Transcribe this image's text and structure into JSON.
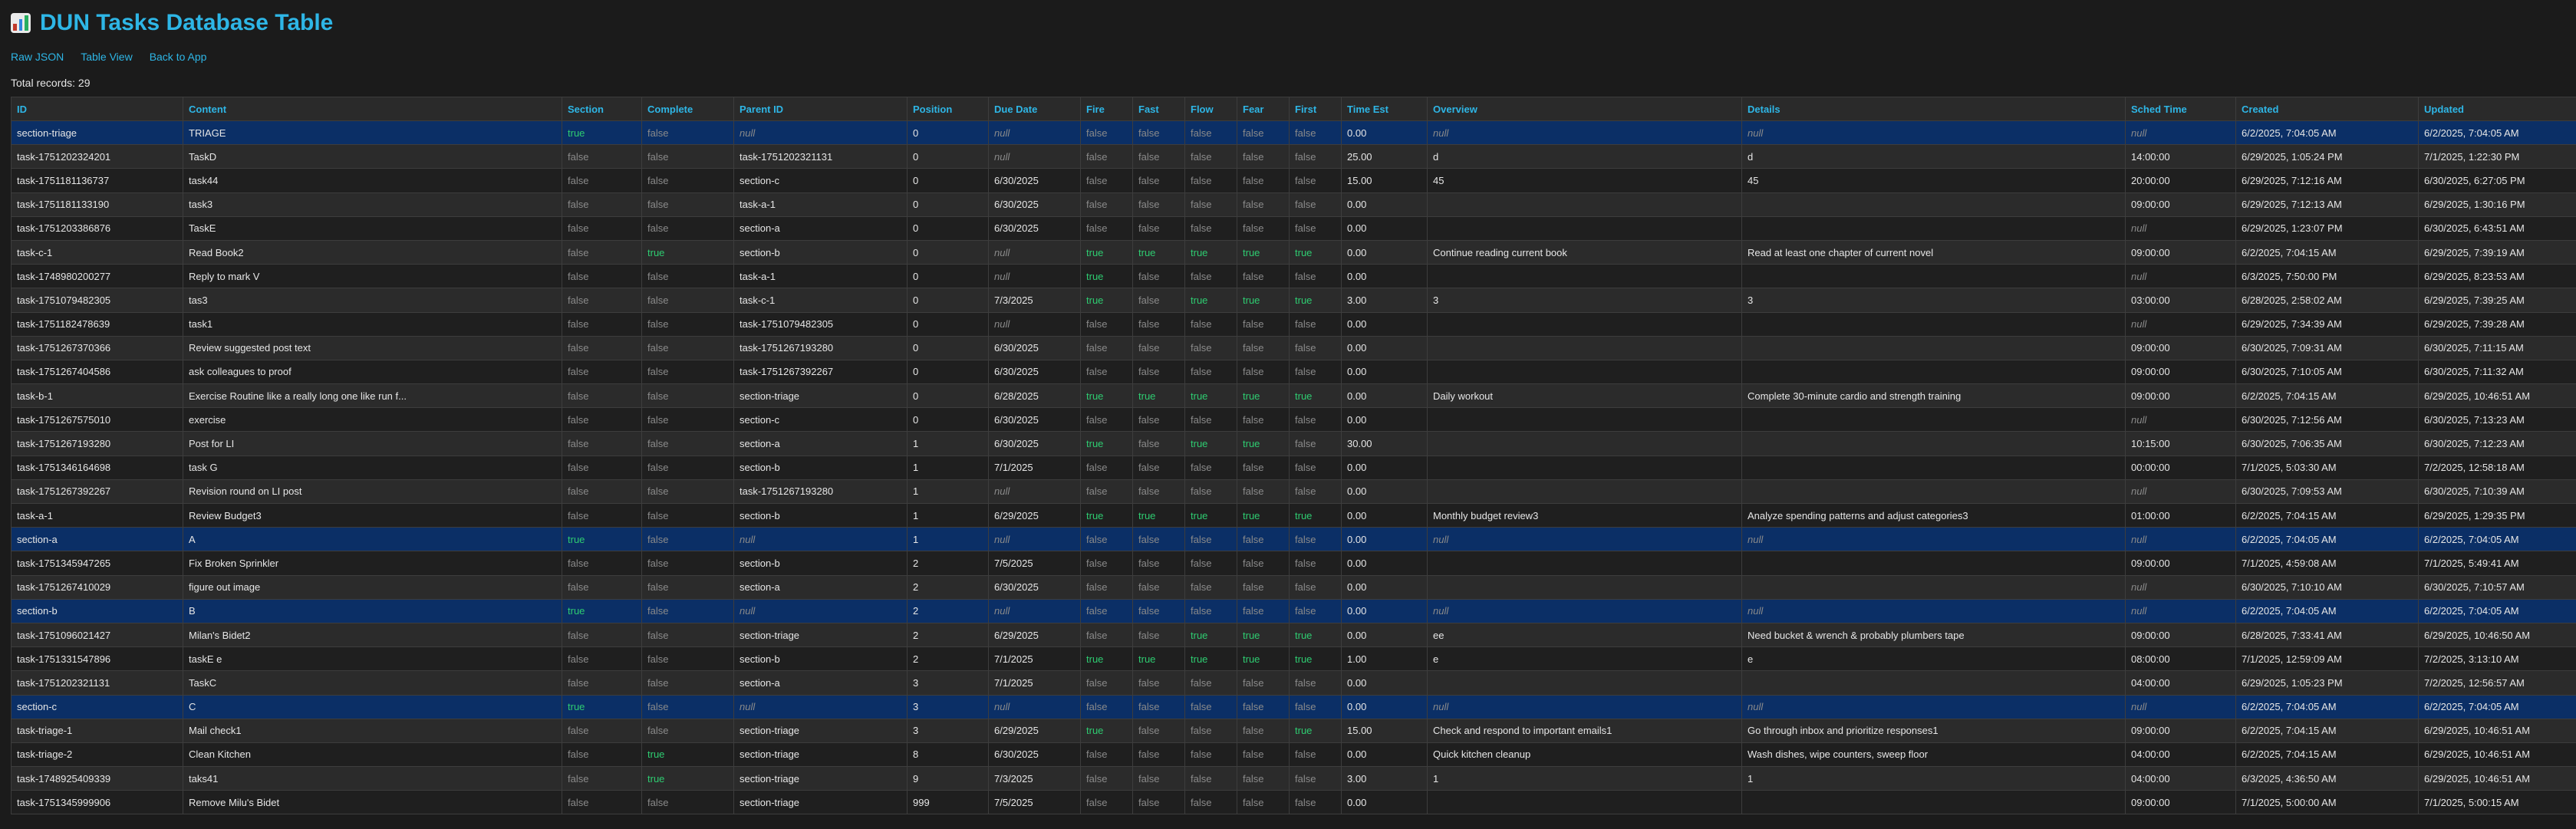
{
  "title": "DUN Tasks Database Table",
  "title_icon": "bar-chart-icon",
  "nav": [
    {
      "label": "Raw JSON"
    },
    {
      "label": "Table View"
    },
    {
      "label": "Back to App"
    }
  ],
  "total_records": "Total records: 29",
  "columns": [
    "ID",
    "Content",
    "Section",
    "Complete",
    "Parent ID",
    "Position",
    "Due Date",
    "Fire",
    "Fast",
    "Flow",
    "Fear",
    "First",
    "Time Est",
    "Overview",
    "Details",
    "Sched Time",
    "Created",
    "Updated"
  ],
  "rows": [
    [
      "section-triage",
      "TRIAGE",
      "true",
      "false",
      "null",
      "0",
      "null",
      "false",
      "false",
      "false",
      "false",
      "false",
      "0.00",
      "null",
      "null",
      "null",
      "6/2/2025, 7:04:05 AM",
      "6/2/2025, 7:04:05 AM"
    ],
    [
      "task-1751202324201",
      "TaskD",
      "false",
      "false",
      "task-1751202321131",
      "0",
      "null",
      "false",
      "false",
      "false",
      "false",
      "false",
      "25.00",
      "d",
      "d",
      "14:00:00",
      "6/29/2025, 1:05:24 PM",
      "7/1/2025, 1:22:30 PM"
    ],
    [
      "task-1751181136737",
      "task44",
      "false",
      "false",
      "section-c",
      "0",
      "6/30/2025",
      "false",
      "false",
      "false",
      "false",
      "false",
      "15.00",
      "45",
      "45",
      "20:00:00",
      "6/29/2025, 7:12:16 AM",
      "6/30/2025, 6:27:05 PM"
    ],
    [
      "task-1751181133190",
      "task3",
      "false",
      "false",
      "task-a-1",
      "0",
      "6/30/2025",
      "false",
      "false",
      "false",
      "false",
      "false",
      "0.00",
      "",
      "",
      "09:00:00",
      "6/29/2025, 7:12:13 AM",
      "6/29/2025, 1:30:16 PM"
    ],
    [
      "task-1751203386876",
      "TaskE",
      "false",
      "false",
      "section-a",
      "0",
      "6/30/2025",
      "false",
      "false",
      "false",
      "false",
      "false",
      "0.00",
      "",
      "",
      "null",
      "6/29/2025, 1:23:07 PM",
      "6/30/2025, 6:43:51 AM"
    ],
    [
      "task-c-1",
      "Read Book2",
      "false",
      "true",
      "section-b",
      "0",
      "null",
      "true",
      "true",
      "true",
      "true",
      "true",
      "0.00",
      "Continue reading current book",
      "Read at least one chapter of current novel",
      "09:00:00",
      "6/2/2025, 7:04:15 AM",
      "6/29/2025, 7:39:19 AM"
    ],
    [
      "task-1748980200277",
      "Reply to mark V",
      "false",
      "false",
      "task-a-1",
      "0",
      "null",
      "true",
      "false",
      "false",
      "false",
      "false",
      "0.00",
      "",
      "",
      "null",
      "6/3/2025, 7:50:00 PM",
      "6/29/2025, 8:23:53 AM"
    ],
    [
      "task-1751079482305",
      "tas3",
      "false",
      "false",
      "task-c-1",
      "0",
      "7/3/2025",
      "true",
      "false",
      "true",
      "true",
      "true",
      "3.00",
      "3",
      "3",
      "03:00:00",
      "6/28/2025, 2:58:02 AM",
      "6/29/2025, 7:39:25 AM"
    ],
    [
      "task-1751182478639",
      "task1",
      "false",
      "false",
      "task-1751079482305",
      "0",
      "null",
      "false",
      "false",
      "false",
      "false",
      "false",
      "0.00",
      "",
      "",
      "null",
      "6/29/2025, 7:34:39 AM",
      "6/29/2025, 7:39:28 AM"
    ],
    [
      "task-1751267370366",
      "Review suggested post text",
      "false",
      "false",
      "task-1751267193280",
      "0",
      "6/30/2025",
      "false",
      "false",
      "false",
      "false",
      "false",
      "0.00",
      "",
      "",
      "09:00:00",
      "6/30/2025, 7:09:31 AM",
      "6/30/2025, 7:11:15 AM"
    ],
    [
      "task-1751267404586",
      "ask colleagues to proof",
      "false",
      "false",
      "task-1751267392267",
      "0",
      "6/30/2025",
      "false",
      "false",
      "false",
      "false",
      "false",
      "0.00",
      "",
      "",
      "09:00:00",
      "6/30/2025, 7:10:05 AM",
      "6/30/2025, 7:11:32 AM"
    ],
    [
      "task-b-1",
      "Exercise Routine like a really long one like run f...",
      "false",
      "false",
      "section-triage",
      "0",
      "6/28/2025",
      "true",
      "true",
      "true",
      "true",
      "true",
      "0.00",
      "Daily workout",
      "Complete 30-minute cardio and strength training",
      "09:00:00",
      "6/2/2025, 7:04:15 AM",
      "6/29/2025, 10:46:51 AM"
    ],
    [
      "task-1751267575010",
      "exercise",
      "false",
      "false",
      "section-c",
      "0",
      "6/30/2025",
      "false",
      "false",
      "false",
      "false",
      "false",
      "0.00",
      "",
      "",
      "null",
      "6/30/2025, 7:12:56 AM",
      "6/30/2025, 7:13:23 AM"
    ],
    [
      "task-1751267193280",
      "Post for LI",
      "false",
      "false",
      "section-a",
      "1",
      "6/30/2025",
      "true",
      "false",
      "true",
      "true",
      "false",
      "30.00",
      "",
      "",
      "10:15:00",
      "6/30/2025, 7:06:35 AM",
      "6/30/2025, 7:12:23 AM"
    ],
    [
      "task-1751346164698",
      "task G",
      "false",
      "false",
      "section-b",
      "1",
      "7/1/2025",
      "false",
      "false",
      "false",
      "false",
      "false",
      "0.00",
      "",
      "",
      "00:00:00",
      "7/1/2025, 5:03:30 AM",
      "7/2/2025, 12:58:18 AM"
    ],
    [
      "task-1751267392267",
      "Revision round on LI post",
      "false",
      "false",
      "task-1751267193280",
      "1",
      "null",
      "false",
      "false",
      "false",
      "false",
      "false",
      "0.00",
      "",
      "",
      "null",
      "6/30/2025, 7:09:53 AM",
      "6/30/2025, 7:10:39 AM"
    ],
    [
      "task-a-1",
      "Review Budget3",
      "false",
      "false",
      "section-b",
      "1",
      "6/29/2025",
      "true",
      "true",
      "true",
      "true",
      "true",
      "0.00",
      "Monthly budget review3",
      "Analyze spending patterns and adjust categories3",
      "01:00:00",
      "6/2/2025, 7:04:15 AM",
      "6/29/2025, 1:29:35 PM"
    ],
    [
      "section-a",
      "A",
      "true",
      "false",
      "null",
      "1",
      "null",
      "false",
      "false",
      "false",
      "false",
      "false",
      "0.00",
      "null",
      "null",
      "null",
      "6/2/2025, 7:04:05 AM",
      "6/2/2025, 7:04:05 AM"
    ],
    [
      "task-1751345947265",
      "Fix Broken Sprinkler",
      "false",
      "false",
      "section-b",
      "2",
      "7/5/2025",
      "false",
      "false",
      "false",
      "false",
      "false",
      "0.00",
      "",
      "",
      "09:00:00",
      "7/1/2025, 4:59:08 AM",
      "7/1/2025, 5:49:41 AM"
    ],
    [
      "task-1751267410029",
      "figure out image",
      "false",
      "false",
      "section-a",
      "2",
      "6/30/2025",
      "false",
      "false",
      "false",
      "false",
      "false",
      "0.00",
      "",
      "",
      "null",
      "6/30/2025, 7:10:10 AM",
      "6/30/2025, 7:10:57 AM"
    ],
    [
      "section-b",
      "B",
      "true",
      "false",
      "null",
      "2",
      "null",
      "false",
      "false",
      "false",
      "false",
      "false",
      "0.00",
      "null",
      "null",
      "null",
      "6/2/2025, 7:04:05 AM",
      "6/2/2025, 7:04:05 AM"
    ],
    [
      "task-1751096021427",
      "Milan's Bidet2",
      "false",
      "false",
      "section-triage",
      "2",
      "6/29/2025",
      "false",
      "false",
      "true",
      "true",
      "true",
      "0.00",
      "ee",
      "Need bucket & wrench & probably plumbers tape",
      "09:00:00",
      "6/28/2025, 7:33:41 AM",
      "6/29/2025, 10:46:50 AM"
    ],
    [
      "task-1751331547896",
      "taskE e",
      "false",
      "false",
      "section-b",
      "2",
      "7/1/2025",
      "true",
      "true",
      "true",
      "true",
      "true",
      "1.00",
      "e",
      "e",
      "08:00:00",
      "7/1/2025, 12:59:09 AM",
      "7/2/2025, 3:13:10 AM"
    ],
    [
      "task-1751202321131",
      "TaskC",
      "false",
      "false",
      "section-a",
      "3",
      "7/1/2025",
      "false",
      "false",
      "false",
      "false",
      "false",
      "0.00",
      "",
      "",
      "04:00:00",
      "6/29/2025, 1:05:23 PM",
      "7/2/2025, 12:56:57 AM"
    ],
    [
      "section-c",
      "C",
      "true",
      "false",
      "null",
      "3",
      "null",
      "false",
      "false",
      "false",
      "false",
      "false",
      "0.00",
      "null",
      "null",
      "null",
      "6/2/2025, 7:04:05 AM",
      "6/2/2025, 7:04:05 AM"
    ],
    [
      "task-triage-1",
      "Mail check1",
      "false",
      "false",
      "section-triage",
      "3",
      "6/29/2025",
      "true",
      "false",
      "false",
      "false",
      "true",
      "15.00",
      "Check and respond to important emails1",
      "Go through inbox and prioritize responses1",
      "09:00:00",
      "6/2/2025, 7:04:15 AM",
      "6/29/2025, 10:46:51 AM"
    ],
    [
      "task-triage-2",
      "Clean Kitchen",
      "false",
      "true",
      "section-triage",
      "8",
      "6/30/2025",
      "false",
      "false",
      "false",
      "false",
      "false",
      "0.00",
      "Quick kitchen cleanup",
      "Wash dishes, wipe counters, sweep floor",
      "04:00:00",
      "6/2/2025, 7:04:15 AM",
      "6/29/2025, 10:46:51 AM"
    ],
    [
      "task-1748925409339",
      "taks41",
      "false",
      "true",
      "section-triage",
      "9",
      "7/3/2025",
      "false",
      "false",
      "false",
      "false",
      "false",
      "3.00",
      "1",
      "1",
      "04:00:00",
      "6/3/2025, 4:36:50 AM",
      "6/29/2025, 10:46:51 AM"
    ],
    [
      "task-1751345999906",
      "Remove Milu's Bidet",
      "false",
      "false",
      "section-triage",
      "999",
      "7/5/2025",
      "false",
      "false",
      "false",
      "false",
      "false",
      "0.00",
      "",
      "",
      "09:00:00",
      "7/1/2025, 5:00:00 AM",
      "7/1/2025, 5:00:15 AM"
    ]
  ],
  "colors": {
    "accent": "#2eb6e6",
    "true": "#2ecc71",
    "false": "#8a8a8a",
    "section_row_bg": "#0b2f66",
    "background": "#1b1b1b"
  }
}
